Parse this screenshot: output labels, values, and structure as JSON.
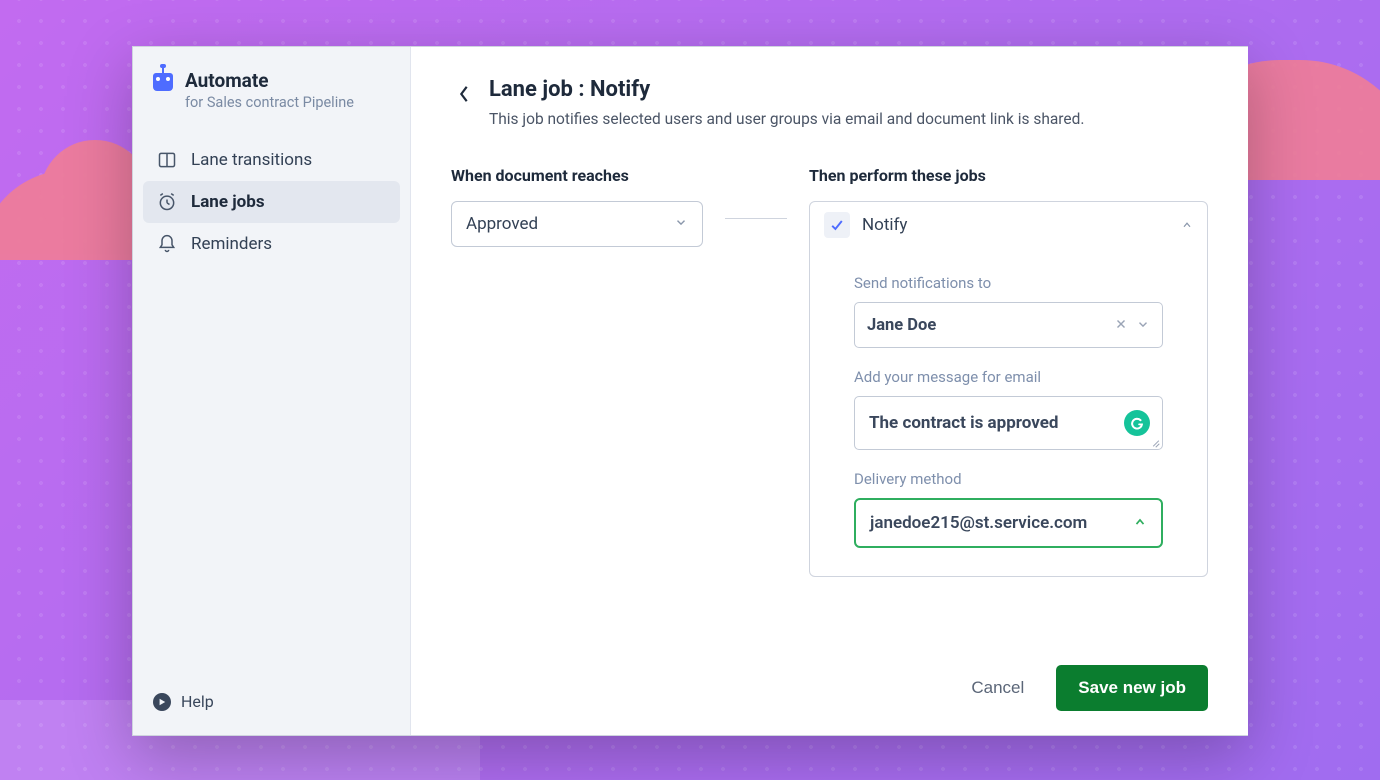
{
  "sidebar": {
    "title": "Automate",
    "subtitle": "for Sales contract Pipeline",
    "nav": [
      {
        "label": "Lane transitions",
        "icon": "columns-icon"
      },
      {
        "label": "Lane jobs",
        "icon": "alarm-icon"
      },
      {
        "label": "Reminders",
        "icon": "bell-icon"
      }
    ],
    "active_index": 1,
    "help_label": "Help"
  },
  "header": {
    "title": "Lane job : Notify",
    "description": "This job notifies selected users and user groups via email and document link is shared."
  },
  "form": {
    "when_label": "When document reaches",
    "when_value": "Approved",
    "then_label": "Then perform these jobs",
    "job_title": "Notify",
    "recipients_label": "Send notifications to",
    "recipients_value": "Jane Doe",
    "message_label": "Add your message for email",
    "message_value": "The contract is approved",
    "delivery_label": "Delivery method",
    "delivery_value": "janedoe215@st.service.com"
  },
  "footer": {
    "cancel": "Cancel",
    "save": "Save new job"
  },
  "colors": {
    "accent_green": "#0b7d2f",
    "accent_blue": "#4e6cff",
    "border_green": "#2fae5f"
  }
}
